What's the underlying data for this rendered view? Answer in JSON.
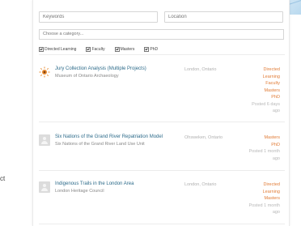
{
  "side_text": "ct",
  "search": {
    "keywords_placeholder": "Keywords",
    "location_placeholder": "Location",
    "category_placeholder": "Choose a category..."
  },
  "filters": [
    {
      "label": "Directed Learning",
      "checked": true
    },
    {
      "label": "Faculty",
      "checked": true
    },
    {
      "label": "Masters",
      "checked": true
    },
    {
      "label": "PhD",
      "checked": true
    }
  ],
  "jobs": [
    {
      "icon": "sun-logo-icon",
      "title": "Jury Collection Analysis (Multiple Projects)",
      "org": "Museum of Ontario Archaeology",
      "location": "London, Ontario",
      "tags": [
        "Directed",
        "Learning",
        "Faculty",
        "Masters",
        "PhD"
      ],
      "posted": [
        "Posted 6 days",
        "ago"
      ]
    },
    {
      "icon": "avatar-placeholder-icon",
      "title": "Six Nations of the Grand River Repatriation Model",
      "org": "Six Nations of the Grand River Land Use Unit",
      "location": "Ohsweken, Ontario",
      "tags": [
        "Masters",
        "PhD"
      ],
      "posted": [
        "Posted 1 month",
        "ago"
      ]
    },
    {
      "icon": "avatar-placeholder-icon",
      "title": "Indigenous Trails in the London Area",
      "org": "London Heritage Council",
      "location": "London, Ontario",
      "tags": [
        "Directed",
        "Learning",
        "Masters"
      ],
      "posted": [
        "Posted 1 month",
        "ago"
      ]
    }
  ],
  "colors": {
    "tag": "#e17d38",
    "title": "#2d6b8a"
  }
}
